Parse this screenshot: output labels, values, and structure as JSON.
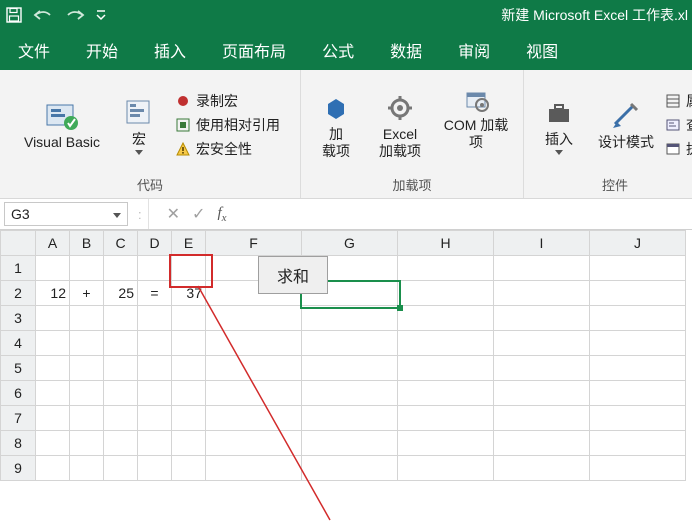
{
  "titlebar": {
    "title": "新建 Microsoft Excel 工作表.xl"
  },
  "tabs": {
    "file": "文件",
    "home": "开始",
    "insert": "插入",
    "layout": "页面布局",
    "formulas": "公式",
    "data": "数据",
    "review": "审阅",
    "view": "视图"
  },
  "ribbon": {
    "code_group": {
      "vb": "Visual Basic",
      "macros": "宏",
      "record": "录制宏",
      "relative": "使用相对引用",
      "security": "宏安全性",
      "label": "代码"
    },
    "addins_group": {
      "addins_top": "加",
      "addins_bottom": "载项",
      "excel_addins_top": "Excel",
      "excel_addins_bottom": "加载项",
      "com_addins": "COM 加载项",
      "label": "加载项"
    },
    "controls_group": {
      "insert": "插入",
      "design": "设计模式",
      "props": "属",
      "viewcode": "查",
      "rundialog": "执",
      "label": "控件"
    }
  },
  "namebox": {
    "value": "G3"
  },
  "grid": {
    "columns": [
      "A",
      "B",
      "C",
      "D",
      "E",
      "F",
      "G",
      "H",
      "I",
      "J"
    ],
    "row2": {
      "A": "12",
      "B": "+",
      "C": "25",
      "D": "=",
      "E": "37"
    },
    "sum_button": "求和"
  }
}
